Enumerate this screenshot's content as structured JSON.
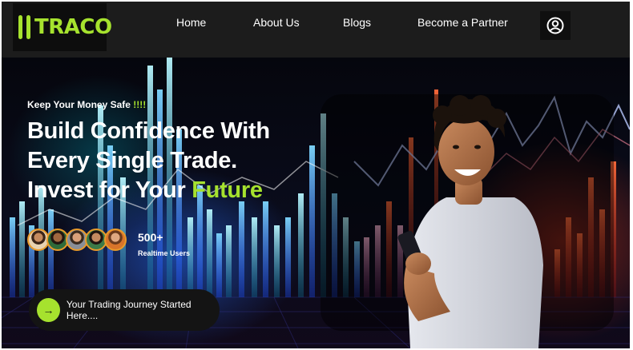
{
  "brand": {
    "name": "TRACO",
    "accent": "#a6e22e"
  },
  "nav": {
    "items": [
      {
        "label": "Home"
      },
      {
        "label": "About Us"
      },
      {
        "label": "Blogs"
      },
      {
        "label": "Become a Partner"
      }
    ],
    "profile_icon": "user-circle-icon"
  },
  "hero": {
    "tagline": "Keep Your Money Safe",
    "tagline_exclaim": "!!!!",
    "headline_line1": "Build Confidence With",
    "headline_line2": "Every Single Trade.",
    "headline_line3_prefix": "Invest for Your",
    "headline_line3_accent": "Future",
    "users_count": "500+",
    "users_label": "Realtime Users",
    "cta_label": "Your Trading Journey Started Here....",
    "cta_icon": "arrow-right-icon"
  }
}
